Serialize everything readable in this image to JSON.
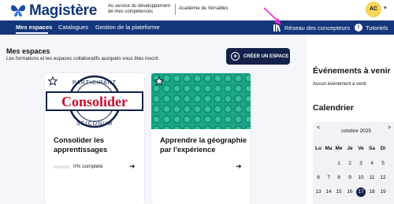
{
  "header": {
    "logo_text": "Magistère",
    "tagline": "Au service du développement de mes compétences",
    "academie": "Académie de Versailles",
    "avatar_initials": "AC"
  },
  "nav": {
    "items": [
      {
        "label": "Mes espaces",
        "active": true
      },
      {
        "label": "Catalogues",
        "active": false
      },
      {
        "label": "Gestion de la plateforme",
        "active": false
      }
    ],
    "network_label": "Réseau des concepteurs",
    "tutorials_label": "Tutoriels"
  },
  "main": {
    "title": "Mes espaces",
    "subtitle": "Les formations et les espaces collaboratifs auxquels vous êtes inscrit.",
    "create_button": "CRÉER UN ESPACE",
    "cards": [
      {
        "title": "Consolider les apprentissages",
        "progress_percent": 0,
        "progress_label": "0% complété",
        "seal": {
          "top": "PARTICIPANT",
          "center": "Consolider",
          "bottom": "SCICONUM"
        }
      },
      {
        "title": "Apprendre la géographie par l'expérience"
      }
    ]
  },
  "sidebar": {
    "events_title": "Événements à venir",
    "events_empty": "Aucun événement à venir",
    "calendar_title": "Calendrier",
    "calendar": {
      "prev": "<",
      "next": ">",
      "month": "octobre 2025",
      "weekdays": [
        "Lu",
        "Ma",
        "Me",
        "Je",
        "Ve",
        "Sa",
        "Di"
      ],
      "weeks": [
        [
          "",
          "",
          "1",
          "2",
          "3",
          "4",
          "5"
        ],
        [
          "6",
          "7",
          "8",
          "9",
          "10",
          "11",
          "12"
        ],
        [
          "13",
          "14",
          "15",
          "16",
          "17",
          "18",
          "19"
        ]
      ],
      "today": "17"
    }
  },
  "colors": {
    "brand_navy": "#14367a",
    "dark_navy": "#14214a",
    "accent_teal": "#1aa689",
    "seal_red": "#c8102e",
    "annotation_magenta": "#e62bd6"
  }
}
